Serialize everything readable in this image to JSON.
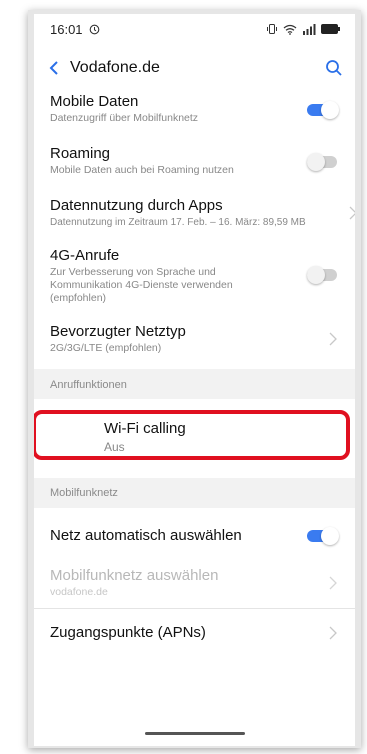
{
  "status": {
    "time": "16:01"
  },
  "header": {
    "title": "Vodafone.de"
  },
  "items": {
    "mobile_data": {
      "title": "Mobile Daten",
      "subtitle": "Datenzugriff über Mobilfunknetz",
      "on": true
    },
    "roaming": {
      "title": "Roaming",
      "subtitle": "Mobile Daten auch bei Roaming nutzen",
      "on": false
    },
    "data_usage": {
      "title": "Datennutzung durch Apps",
      "subtitle": "Datennutzung im Zeitraum 17. Feb. – 16. März: 89,59 MB"
    },
    "volte": {
      "title": "4G-Anrufe",
      "subtitle_1": "Zur Verbesserung von Sprache und",
      "subtitle_2": "Kommunikation 4G-Dienste verwenden",
      "subtitle_3": "(empfohlen)",
      "on": false
    },
    "network_type": {
      "title": "Bevorzugter Netztyp",
      "subtitle": "2G/3G/LTE (empfohlen)"
    },
    "wifi_calling": {
      "title": "Wi-Fi calling",
      "subtitle": "Aus"
    },
    "auto_network": {
      "title": "Netz automatisch auswählen",
      "on": true
    },
    "select_network": {
      "title": "Mobilfunknetz auswählen",
      "subtitle": "vodafone.de"
    },
    "apn": {
      "title": "Zugangspunkte (APNs)"
    }
  },
  "sections": {
    "call_features": "Anruffunktionen",
    "mobile_network": "Mobilfunknetz"
  },
  "colors": {
    "accent": "#3a7bf0",
    "highlight": "#e01020"
  }
}
